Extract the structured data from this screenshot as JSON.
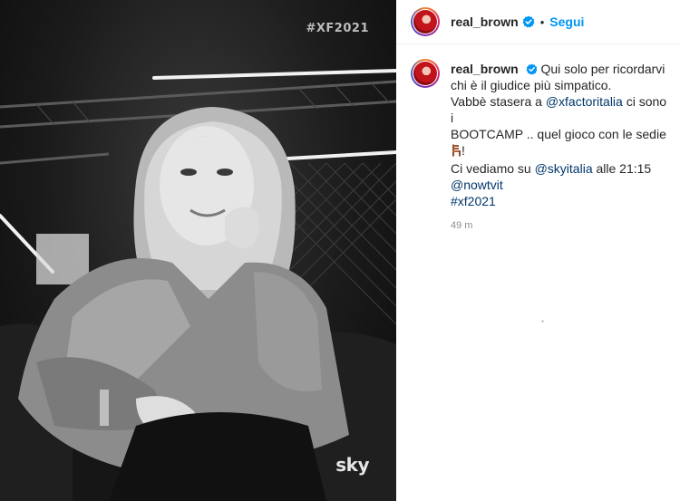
{
  "photo": {
    "overlay_hashtag": "#XF2021",
    "watermark": "sky"
  },
  "header": {
    "username": "real_brown",
    "dot": "•",
    "follow_label": "Segui"
  },
  "caption": {
    "username": "real_brown",
    "line1": "Qui solo per ricordarvi",
    "line2": "chi è il giudice più simpatico.",
    "line3_prefix": "Vabbè stasera a ",
    "line3_mention": "@xfactoritalia",
    "line3_suffix": " ci sono i",
    "line4": "BOOTCAMP .. quel gioco con le sedie",
    "line5_suffix": "!",
    "line6_prefix": "Ci vediamo su ",
    "line6_mention": "@skyitalia",
    "line6_suffix": " alle 21:15",
    "mention_nowtv": "@nowtvit",
    "hashtag": "#xf2021",
    "time": "49 m"
  },
  "colors": {
    "link": "#00376b",
    "follow": "#0095f6",
    "verified": "#0095f6"
  },
  "icons": {
    "verified": "verified-badge-icon",
    "chair": "chair-emoji-icon"
  }
}
